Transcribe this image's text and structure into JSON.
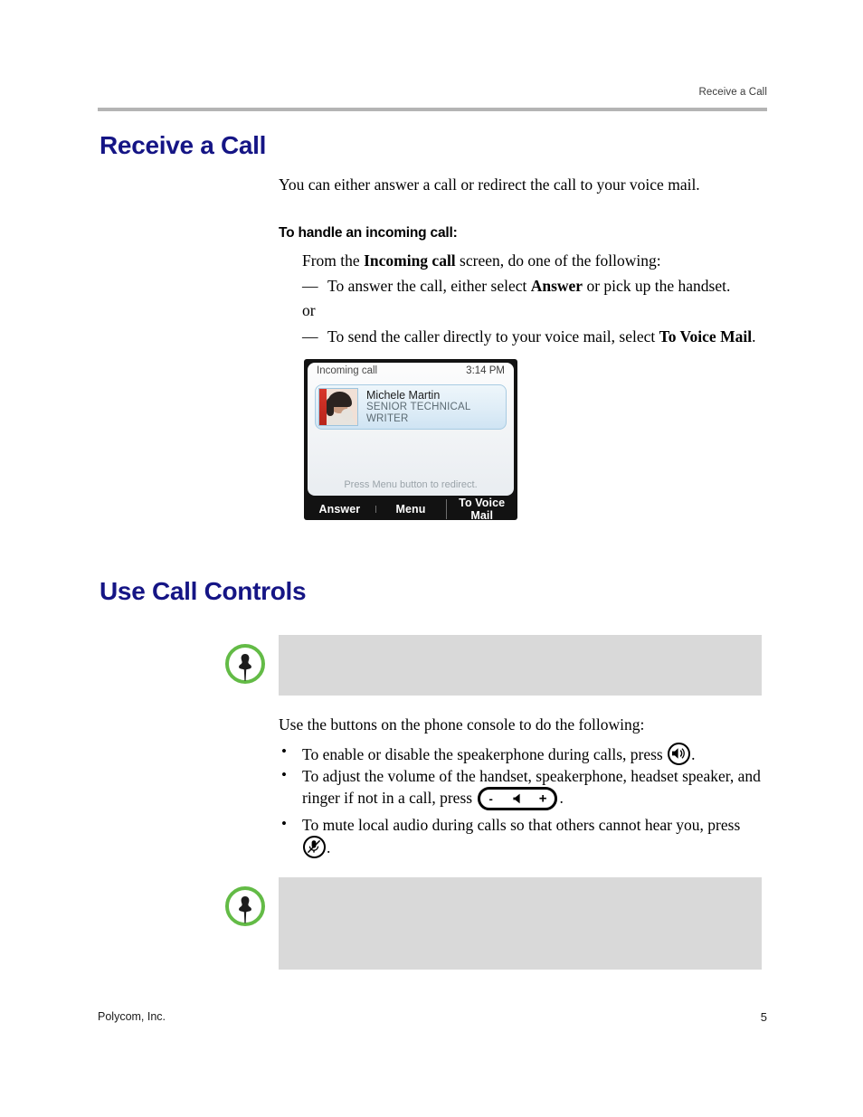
{
  "document": {
    "running_header": "Receive a Call",
    "footer_left": "Polycom, Inc.",
    "footer_page_number": "5"
  },
  "colors": {
    "heading_blue": "#151585",
    "note_icon_green": "#63bb46",
    "note_box_gray": "#d9d9d9",
    "header_rule_gray": "#b4b4b4"
  },
  "sections": {
    "receive_a_call": {
      "heading": "Receive a Call",
      "intro": "You can either answer a call or redirect the call to your voice mail.",
      "subheading": "To handle an incoming call:",
      "lead_in_prefix": "From the ",
      "lead_in_bold": "Incoming call",
      "lead_in_suffix": " screen, do one of the following:",
      "steps": [
        {
          "marker": "—",
          "prefix": "To answer the call, either select ",
          "bold": "Answer",
          "suffix": " or pick up the handset."
        },
        {
          "marker": "—",
          "prefix": "To send the caller directly to your voice mail, select ",
          "bold": "To Voice Mail",
          "suffix": "."
        }
      ],
      "or_label": "or"
    },
    "use_call_controls": {
      "heading": "Use Call Controls",
      "lead_in": "Use the buttons on the phone console to do the following:",
      "bullets": [
        {
          "dot": "•",
          "prefix": "To enable or disable the speakerphone during calls, press ",
          "icon": "speakerphone-key-icon",
          "suffix": "."
        },
        {
          "dot": "•",
          "prefix": "To adjust the volume of the handset, speakerphone, headset speaker, and ringer if not in a call, press ",
          "icon": "volume-key-icon",
          "suffix": "."
        },
        {
          "dot": "•",
          "prefix": "To mute local audio during calls so that others cannot hear you, press ",
          "icon": "mute-key-icon",
          "suffix": "."
        }
      ],
      "notes": [
        {
          "icon": "note-pin-icon",
          "text": ""
        },
        {
          "icon": "note-pin-icon",
          "text": ""
        }
      ]
    }
  },
  "figure_phone_screen": {
    "status_title": "Incoming call",
    "status_time": "3:14 PM",
    "contact_name": "Michele Martin",
    "contact_title": "SENIOR TECHNICAL WRITER",
    "hint": "Press Menu button to redirect.",
    "softkeys": [
      {
        "label": "Answer"
      },
      {
        "label": "Menu"
      },
      {
        "label": "To Voice Mail"
      }
    ]
  },
  "key_glyphs": {
    "volume_minus": "-",
    "volume_plus": "+"
  }
}
